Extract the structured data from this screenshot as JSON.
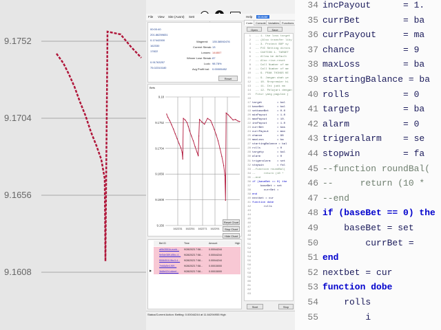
{
  "background_left": {
    "ticks": [
      "9.1752",
      "9.1704",
      "9.1656",
      "9.1608"
    ]
  },
  "background_right": {
    "lines": [
      {
        "num": "34",
        "text": "incPayout      = 1.",
        "kind": "code"
      },
      {
        "num": "35",
        "text": "currBet        = ba",
        "kind": "code"
      },
      {
        "num": "36",
        "text": "currPayout     = ma",
        "kind": "code"
      },
      {
        "num": "37",
        "text": "chance         = 9",
        "kind": "code"
      },
      {
        "num": "38",
        "text": "maxLoss        = ba",
        "kind": "code"
      },
      {
        "num": "39",
        "text": "startingBalance = ba",
        "kind": "code"
      },
      {
        "num": "40",
        "text": "rolls          = 0",
        "kind": "code"
      },
      {
        "num": "41",
        "text": "targetp        = ba",
        "kind": "code"
      },
      {
        "num": "42",
        "text": "alarm          = 0",
        "kind": "code"
      },
      {
        "num": "43",
        "text": "trigeralarm    = se",
        "kind": "code"
      },
      {
        "num": "44",
        "text": "stopwin        = fa",
        "kind": "code"
      },
      {
        "num": "45",
        "text": "--function roundBal(",
        "kind": "comment"
      },
      {
        "num": "46",
        "text": "--     return (10 *",
        "kind": "comment"
      },
      {
        "num": "47",
        "text": "--end",
        "kind": "comment"
      },
      {
        "num": "48",
        "text": "if (baseBet == 0) the",
        "kind": "keyword"
      },
      {
        "num": "49",
        "text": "    baseBet = set",
        "kind": "code"
      },
      {
        "num": "50",
        "text": "        currBet =",
        "kind": "code"
      },
      {
        "num": "51",
        "text": "end",
        "kind": "keyword"
      },
      {
        "num": "52",
        "text": "nextbet = cur",
        "kind": "code"
      },
      {
        "num": "53",
        "text": "function dobe",
        "kind": "keyword"
      },
      {
        "num": "54",
        "text": "    rolls",
        "kind": "code"
      },
      {
        "num": "55",
        "text": "        i",
        "kind": "code"
      }
    ]
  },
  "toolbar_icons": [
    "zoom-in-icon",
    "record-icon",
    "keyboard-icon"
  ],
  "menu": {
    "left": [
      "File",
      "View",
      "Site (Ausnt)",
      "Sett"
    ],
    "right": [
      "Help",
      "Donate"
    ]
  },
  "stats": {
    "left_values": [
      "00:00:40",
      "201.86259831",
      "0.17442000",
      "162330",
      "17822",
      "",
      "0.91763257",
      "75.02310180"
    ],
    "labels": [
      "Wagered:",
      "Current Streak:",
      "Losses:",
      "Winner Lose Streak:",
      "Luck:",
      "Avg Profit bal:"
    ],
    "values": [
      "135.38592476",
      "13",
      "144807",
      "87",
      "98.78%",
      "0.00005452"
    ],
    "reset_label": "Reset"
  },
  "chart_panel": {
    "title": "Bets",
    "buttons": [
      "Reset Chart",
      "Stop Chart",
      "Hide Chart"
    ]
  },
  "chart_data": {
    "type": "line",
    "title": "",
    "y_ticks": [
      "9.18",
      "9.1752",
      "9.1704",
      "9.1656",
      "9.1608",
      "9.156"
    ],
    "x_ticks": [
      "162231",
      "162251",
      "162271",
      "162291",
      "162311"
    ],
    "ylim": [
      9.156,
      9.18
    ],
    "xlim": [
      162211,
      162331
    ],
    "grid": true,
    "series_color": "#b0163a",
    "x": [
      162213,
      162215,
      162218,
      162221,
      162224,
      162227,
      162230,
      162233,
      162236,
      162238,
      162239,
      162240,
      162243,
      162246,
      162248,
      162250,
      162253,
      162256,
      162259,
      162262,
      162264,
      162265,
      162266,
      162270,
      162274,
      162279,
      162284,
      162287,
      162290,
      162293,
      162296,
      162299,
      162302,
      162305,
      162307,
      162308,
      162309,
      162312,
      162316,
      162320,
      162324,
      162328,
      162331
    ],
    "y": [
      9.1768,
      9.1762,
      9.1756,
      9.1748,
      9.174,
      9.1731,
      9.1722,
      9.1713,
      9.1705,
      9.1697,
      9.1684,
      9.176,
      9.1757,
      9.1752,
      9.1745,
      9.1737,
      9.1727,
      9.1718,
      9.1707,
      9.1697,
      9.169,
      9.1727,
      9.1758,
      9.1753,
      9.1749,
      9.176,
      9.1756,
      9.1748,
      9.1739,
      9.1729,
      9.1718,
      9.1704,
      9.1689,
      9.1672,
      9.1653,
      9.1607,
      9.177,
      9.1767,
      9.1762,
      9.1757,
      9.1758,
      9.1755,
      9.1754
    ]
  },
  "grid_table": {
    "headers": [
      "Bet ID",
      "Time",
      "Amount",
      "High"
    ],
    "rows": [
      {
        "id": "af9b3551b-eceb...",
        "time": "9/28/2023 7:58...",
        "amount": "0.00044244",
        "high": ""
      },
      {
        "id": "9e5de389-d5bc-4...",
        "time": "9/28/2023 7:58...",
        "amount": "0.00044244",
        "high": ""
      },
      {
        "id": "f5084510-9bc3-4...",
        "time": "9/28/2023 7:58...",
        "amount": "0.00044244",
        "high": ""
      },
      {
        "id": "7eb8a5e4-f69...",
        "time": "9/28/2023 7:58...",
        "amount": "0.00015000",
        "high": ""
      },
      {
        "id": "3b6fe024-ddeef...",
        "time": "9/28/2023 7:58...",
        "amount": "0.00015000",
        "high": ""
      }
    ]
  },
  "script_panel": {
    "tabs": [
      "Code",
      "Console",
      "Variables",
      "Functions"
    ],
    "open_label": "Open",
    "save_label": "Save",
    "start_label": "Start",
    "stop_label": "Stop"
  },
  "editor_lines": [
    {
      "n": "1",
      "t": "  -- 1. Use loss target",
      "k": "c"
    },
    {
      "n": "2",
      "t": "  -- (Also transfer liky",
      "k": "c"
    },
    {
      "n": "3",
      "t": "  -- 3. Protect BOP sy",
      "k": "c"
    },
    {
      "n": "4",
      "t": "  -- FUI Setting dirocs",
      "k": "c"
    },
    {
      "n": "5",
      "t": "  -- CAUTION 1. TARGET",
      "k": "c"
    },
    {
      "n": "6",
      "t": "  -- Allow be default",
      "k": "c"
    },
    {
      "n": "7",
      "t": "  -- Also rise-reset",
      "k": "c"
    },
    {
      "n": "8",
      "t": "  -- Call Number of me",
      "k": "c"
    },
    {
      "n": "9",
      "t": "  -- Call Number of me",
      "k": "c"
    },
    {
      "n": "10",
      "t": "  -- 9. PEAK THINGS KE",
      "k": "c"
    },
    {
      "n": "11",
      "t": "  -- 9. Jangan ubah ye",
      "k": "c"
    },
    {
      "n": "12",
      "t": "  -- 10. Rrepremier hi",
      "k": "c"
    },
    {
      "n": "13",
      "t": "  -- 11. Ini judi mo",
      "k": "c"
    },
    {
      "n": "14",
      "t": "  -- 12. Pelajari dengan",
      "k": "c"
    },
    {
      "n": "15",
      "t": "  Fitur yang pagulan j",
      "k": "c"
    },
    {
      "n": "16",
      "t": "",
      "k": "p"
    },
    {
      "n": "17",
      "t": "target         = bal",
      "k": "p"
    },
    {
      "n": "18",
      "t": "baseBet        = bal",
      "k": "p"
    },
    {
      "n": "19",
      "t": "setbaseBet     = 0.0",
      "k": "p"
    },
    {
      "n": "20",
      "t": "minPayout      = 1.0",
      "k": "p"
    },
    {
      "n": "21",
      "t": "maxPayout      = 10.",
      "k": "p"
    },
    {
      "n": "22",
      "t": "incPayout      = 1.0",
      "k": "p"
    },
    {
      "n": "23",
      "t": "currBet        = bas",
      "k": "p"
    },
    {
      "n": "24",
      "t": "currPayout     = max",
      "k": "p"
    },
    {
      "n": "25",
      "t": "chance         = 98",
      "k": "p"
    },
    {
      "n": "26",
      "t": "maxLoss        = ba",
      "k": "p"
    },
    {
      "n": "27",
      "t": "startingBalance = bal",
      "k": "p"
    },
    {
      "n": "28",
      "t": "rolls          = 0",
      "k": "p"
    },
    {
      "n": "29",
      "t": "targetp        = bal",
      "k": "p"
    },
    {
      "n": "30",
      "t": "alarm          = 0",
      "k": "p"
    },
    {
      "n": "31",
      "t": "trigeralarm    = set",
      "k": "p"
    },
    {
      "n": "32",
      "t": "stopwin        = fal",
      "k": "p"
    },
    {
      "n": "33",
      "t": "--function roundBal(",
      "k": "c"
    },
    {
      "n": "34",
      "t": "--     return (10 *",
      "k": "c"
    },
    {
      "n": "35",
      "t": "--end",
      "k": "c"
    },
    {
      "n": "36",
      "t": "if (baseBet == 0) the",
      "k": "k"
    },
    {
      "n": "37",
      "t": "     baseBet = set",
      "k": "p"
    },
    {
      "n": "38",
      "t": "       currBet =",
      "k": "p"
    },
    {
      "n": "39",
      "t": "end",
      "k": "k"
    },
    {
      "n": "40",
      "t": "nextbet = cur",
      "k": "p"
    },
    {
      "n": "41",
      "t": "function dobe",
      "k": "k"
    },
    {
      "n": "42",
      "t": "       rolls",
      "k": "p"
    },
    {
      "n": "43",
      "t": "",
      "k": "p"
    },
    {
      "n": "44",
      "t": "",
      "k": "p"
    },
    {
      "n": "45",
      "t": "",
      "k": "p"
    },
    {
      "n": "46",
      "t": "",
      "k": "p"
    },
    {
      "n": "47",
      "t": "",
      "k": "p"
    },
    {
      "n": "48",
      "t": "",
      "k": "p"
    },
    {
      "n": "49",
      "t": "",
      "k": "p"
    },
    {
      "n": "50",
      "t": "",
      "k": "p"
    },
    {
      "n": "51",
      "t": "",
      "k": "p"
    },
    {
      "n": "52",
      "t": "",
      "k": "p"
    },
    {
      "n": "53",
      "t": "",
      "k": "p"
    },
    {
      "n": "54",
      "t": "",
      "k": "p"
    },
    {
      "n": "55",
      "t": "",
      "k": "p"
    },
    {
      "n": "56",
      "t": "",
      "k": "p"
    },
    {
      "n": "57",
      "t": "",
      "k": "p"
    },
    {
      "n": "58",
      "t": "",
      "k": "p"
    },
    {
      "n": "59",
      "t": "",
      "k": "p"
    },
    {
      "n": "60",
      "t": "",
      "k": "p"
    },
    {
      "n": "61",
      "t": "",
      "k": "p"
    },
    {
      "n": "62",
      "t": "",
      "k": "p"
    },
    {
      "n": "63",
      "t": "",
      "k": "p"
    }
  ],
  "status_bar": {
    "text": "Status/Current Action:   Betting: 0.00044244 at 11.64294955 High"
  }
}
